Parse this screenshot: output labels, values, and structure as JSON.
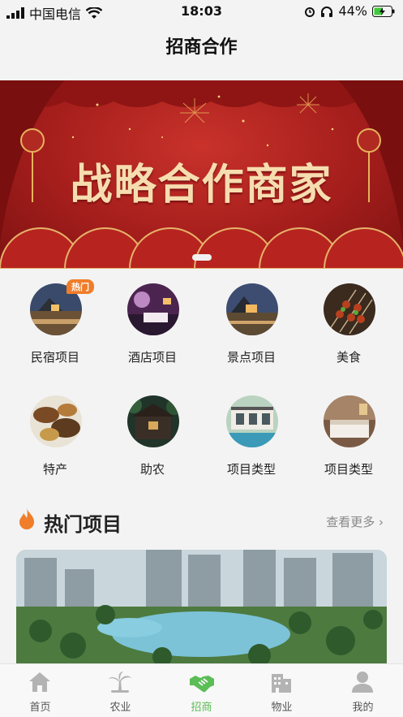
{
  "status_bar": {
    "carrier": "中国电信",
    "time": "18:03",
    "battery": "44%"
  },
  "header": {
    "title": "招商合作"
  },
  "banner": {
    "headline": "战略合作商家"
  },
  "categories": [
    {
      "label": "民宿项目",
      "badge": "热门"
    },
    {
      "label": "酒店项目"
    },
    {
      "label": "景点项目"
    },
    {
      "label": "美食"
    },
    {
      "label": "特产"
    },
    {
      "label": "助农"
    },
    {
      "label": "项目类型"
    },
    {
      "label": "项目类型"
    }
  ],
  "hot_section": {
    "title": "热门项目",
    "more": "查看更多"
  },
  "tabbar": [
    {
      "label": "首页",
      "icon": "home-icon"
    },
    {
      "label": "农业",
      "icon": "palm-tree-icon"
    },
    {
      "label": "招商",
      "icon": "handshake-icon",
      "active": true
    },
    {
      "label": "物业",
      "icon": "building-icon"
    },
    {
      "label": "我的",
      "icon": "user-icon"
    }
  ],
  "colors": {
    "accent": "#5bbd55",
    "badge": "#f07d2a",
    "fire": "#f07d2a",
    "banner": "#a51e1c"
  }
}
